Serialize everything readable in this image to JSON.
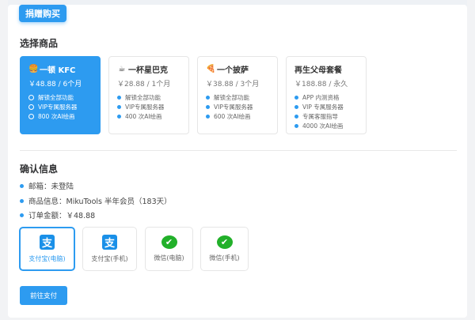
{
  "tab": "捐赠购买",
  "select_title": "选择商品",
  "products": [
    {
      "icon": "🍔",
      "name": "一顿 KFC",
      "price": "￥48.88",
      "period": "6个月",
      "features": [
        "解锁全部功能",
        "VIP专属服务器",
        "800 次AI绘画"
      ]
    },
    {
      "icon": "☕",
      "name": "一杯星巴克",
      "price": "￥28.88",
      "period": "1个月",
      "features": [
        "解锁全部功能",
        "VIP专属服务器",
        "400 次AI绘画"
      ]
    },
    {
      "icon": "🍕",
      "name": "一个披萨",
      "price": "￥38.88",
      "period": "3个月",
      "features": [
        "解锁全部功能",
        "VIP专属服务器",
        "600 次AI绘画"
      ]
    },
    {
      "icon": "",
      "name": "再生父母套餐",
      "price": "￥188.88",
      "period": "永久",
      "features": [
        "APP 内测资格",
        "VIP 专属服务器",
        "专属客服指导",
        "4000 次AI绘画"
      ]
    }
  ],
  "confirm_title": "确认信息",
  "info": [
    "邮箱：未登陆",
    "商品信息：MikuTools 半年会员（183天）",
    "订单金额：￥48.88"
  ],
  "payments": [
    "支付宝(电脑)",
    "支付宝(手机)",
    "微信(电脑)",
    "微信(手机)"
  ],
  "pay_button": "前往支付"
}
